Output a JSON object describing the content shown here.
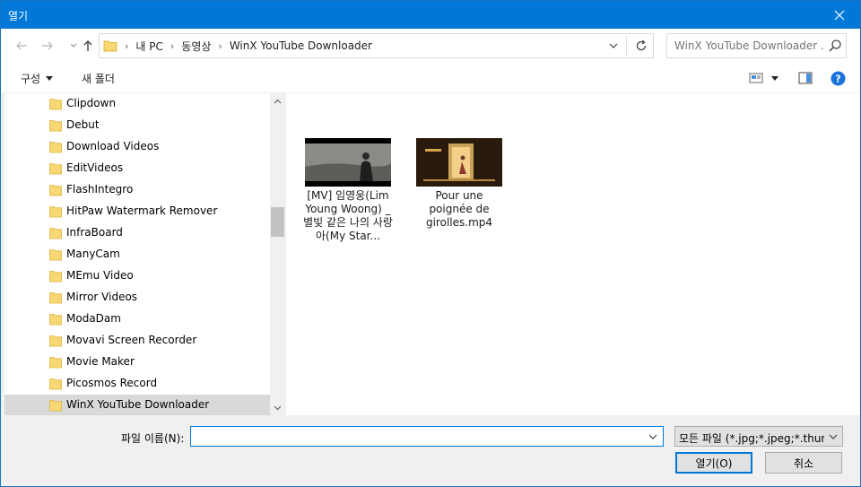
{
  "window": {
    "title": "열기",
    "accent": "#0078d7"
  },
  "nav": {
    "back_icon": "back-arrow-icon",
    "forward_icon": "forward-arrow-icon",
    "up_icon": "up-arrow-icon"
  },
  "address": {
    "crumbs": [
      "내 PC",
      "동영상",
      "WinX YouTube Downloader"
    ]
  },
  "search": {
    "placeholder": "WinX YouTube Downloader ..."
  },
  "toolbar": {
    "organize_label": "구성",
    "new_folder_label": "새 폴더"
  },
  "tree": {
    "items": [
      {
        "label": "Clipdown"
      },
      {
        "label": "Debut"
      },
      {
        "label": "Download Videos"
      },
      {
        "label": "EditVideos"
      },
      {
        "label": "FlashIntegro"
      },
      {
        "label": "HitPaw Watermark Remover"
      },
      {
        "label": "InfraBoard"
      },
      {
        "label": "ManyCam"
      },
      {
        "label": "MEmu Video"
      },
      {
        "label": "Mirror Videos"
      },
      {
        "label": "ModaDam"
      },
      {
        "label": "Movavi Screen Recorder"
      },
      {
        "label": "Movie Maker"
      },
      {
        "label": "Picosmos Record"
      },
      {
        "label": "WinX YouTube Downloader",
        "selected": true
      }
    ]
  },
  "files": [
    {
      "name": "[MV] 임영웅(Lim Young Woong) _ 별빛 같은 나의 사랑아(My Star..."
    },
    {
      "name": "Pour une poignée de girolles.mp4"
    }
  ],
  "footer": {
    "filename_label": "파일 이름(N):",
    "filename_value": "",
    "filter_value": "모든 파일 (*.jpg;*.jpeg;*.thumb",
    "open_label": "열기(O)",
    "cancel_label": "취소"
  }
}
